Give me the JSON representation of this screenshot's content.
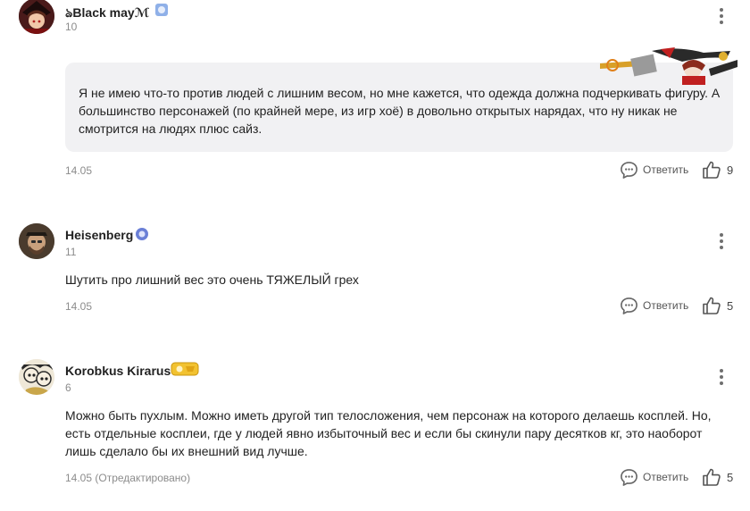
{
  "comments": [
    {
      "username": "ঌBlack mayℳ",
      "level": "10",
      "text": "Я не имею что-то против людей с лишним весом, но мне кажется, что одежда должна подчеркивать фигуру. А большинство персонажей (по крайней мере, из игр хоё) в довольно открытых нарядах, что ну никак не смотрится на людях плюс сайз.",
      "date": "14.05",
      "reply_label": "Ответить",
      "likes": "9",
      "avatar_icon": "anime-avatar-icon",
      "badge_color": "#8fb0e8"
    },
    {
      "username": "Heisenberg",
      "level": "11",
      "text": "Шутить про лишний вес это очень ТЯЖЕЛЫЙ грех",
      "date": "14.05",
      "reply_label": "Ответить",
      "likes": "5",
      "avatar_icon": "bearded-man-avatar-icon",
      "badge_color": "#6a7fd6"
    },
    {
      "username": "Korobkus Kirarus",
      "level": "6",
      "text": "Можно быть пухлым. Можно иметь другой тип телосложения, чем персонаж на которого делаешь косплей. Но, есть отдельные косплеи, где у людей явно избыточный вес и если бы скинули пару десятков кг, это наоборот лишь сделало бы их внешний вид лучше.",
      "date": "14.05 (Отредактировано)",
      "reply_label": "Ответить",
      "likes": "5",
      "avatar_icon": "manga-avatar-icon",
      "badge_color": "#f2c230"
    }
  ],
  "icons": {
    "reply": "speech-bubble-icon",
    "like": "thumbs-up-icon",
    "more": "vertical-dots-icon"
  }
}
